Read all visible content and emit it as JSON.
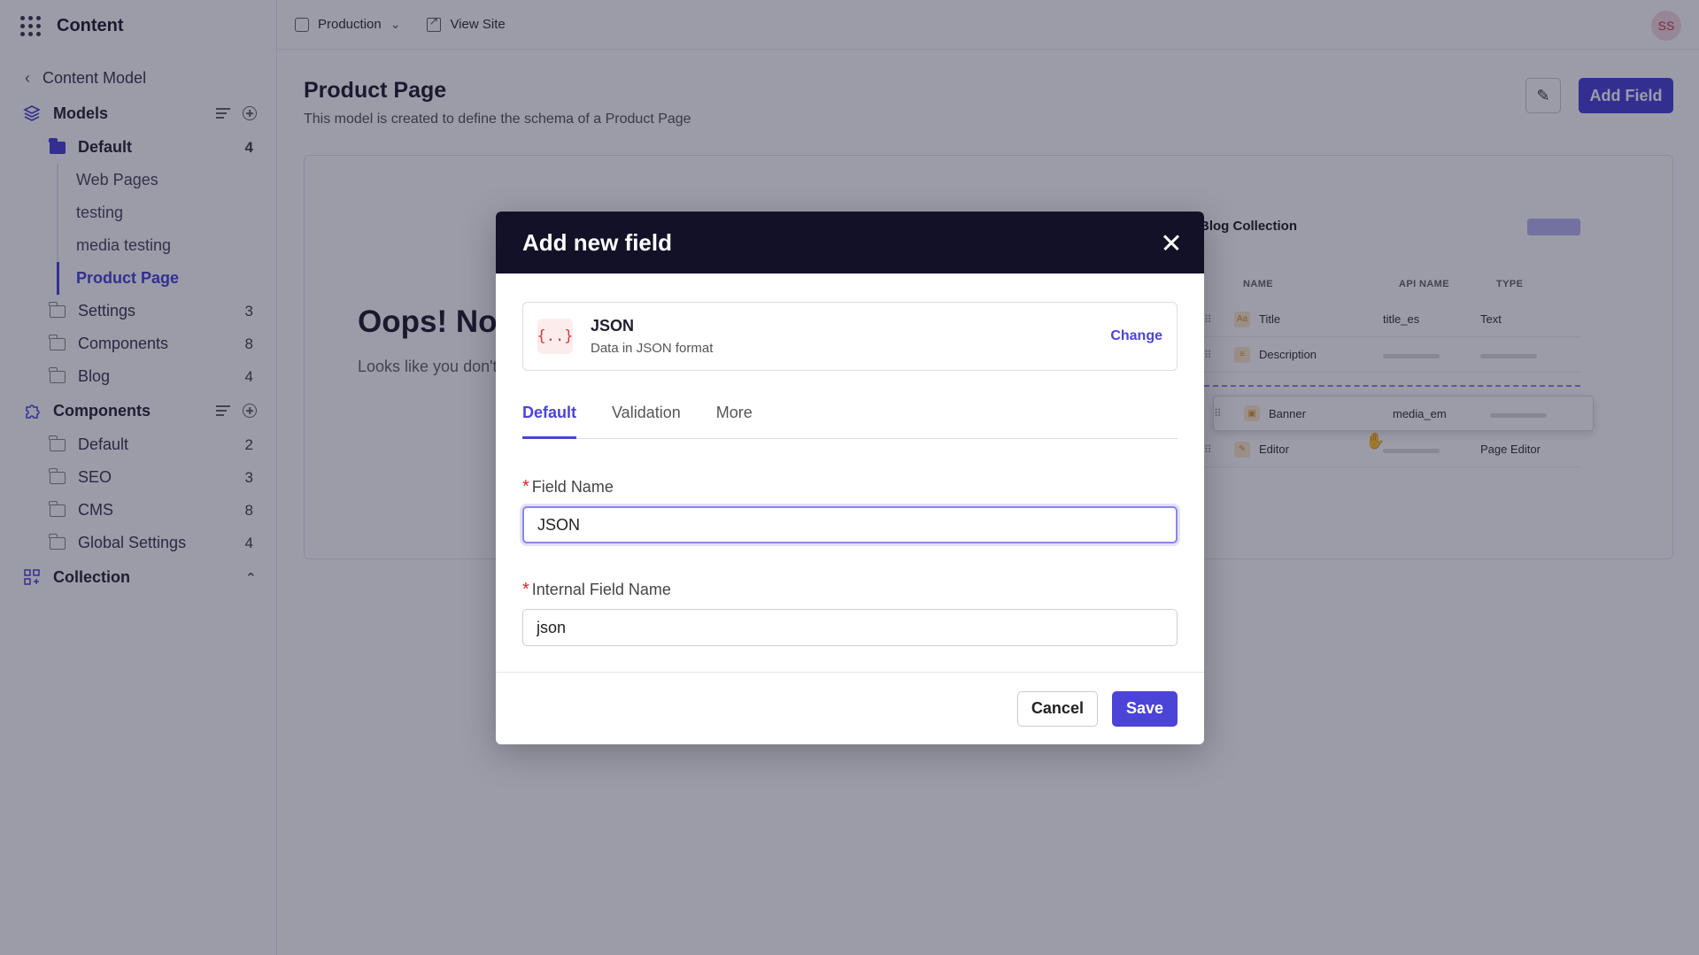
{
  "app": {
    "title": "Content"
  },
  "sidebar": {
    "back_label": "Content Model",
    "models": {
      "label": "Models",
      "folders": [
        {
          "label": "Default",
          "count": "4",
          "items": [
            "Web Pages",
            "testing",
            "media testing",
            "Product Page"
          ],
          "active_item": "Product Page"
        },
        {
          "label": "Settings",
          "count": "3"
        },
        {
          "label": "Components",
          "count": "8"
        },
        {
          "label": "Blog",
          "count": "4"
        }
      ]
    },
    "components": {
      "label": "Components",
      "folders": [
        {
          "label": "Default",
          "count": "2"
        },
        {
          "label": "SEO",
          "count": "3"
        },
        {
          "label": "CMS",
          "count": "8"
        },
        {
          "label": "Global Settings",
          "count": "4"
        }
      ]
    },
    "collection": {
      "label": "Collection"
    }
  },
  "topbar": {
    "environment": "Production",
    "view_site": "View Site",
    "avatar_initials": "SS"
  },
  "page": {
    "title": "Product Page",
    "description": "This model is created to define the schema of a Product Page",
    "add_field_label": "Add Field"
  },
  "empty_state": {
    "title": "Oops! No",
    "subtitle": "Looks like you don't"
  },
  "preview": {
    "title": "Blog Collection",
    "headers": {
      "name": "NAME",
      "api": "API NAME",
      "type": "TYPE"
    },
    "rows": [
      {
        "name": "Title",
        "api": "title_es",
        "type": "Text",
        "icon": "Aa"
      },
      {
        "name": "Description",
        "api": "",
        "type": "",
        "icon": "≡"
      },
      {
        "name": "Banner",
        "api": "media_em",
        "type": "",
        "icon": "▣"
      },
      {
        "name": "Editor",
        "api": "",
        "type": "Page Editor",
        "icon": "✎"
      }
    ]
  },
  "modal": {
    "title": "Add new field",
    "field_type": {
      "name": "JSON",
      "description": "Data in JSON format",
      "icon_glyph": "{..}",
      "change_label": "Change"
    },
    "tabs": [
      {
        "label": "Default",
        "active": true
      },
      {
        "label": "Validation",
        "active": false
      },
      {
        "label": "More",
        "active": false
      }
    ],
    "field_name": {
      "label": "Field Name",
      "value": "JSON"
    },
    "internal_name": {
      "label": "Internal Field Name",
      "value": "json"
    },
    "cancel_label": "Cancel",
    "save_label": "Save"
  },
  "colors": {
    "accent": "#4b44d6",
    "modal_header": "#131128",
    "required": "#d42626"
  }
}
